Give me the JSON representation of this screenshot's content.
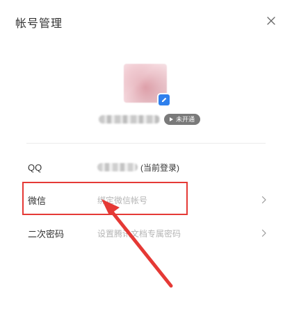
{
  "dialog": {
    "title": "帐号管理",
    "close_icon": "close-icon"
  },
  "profile": {
    "avatar_icon": "avatar",
    "badge_icon": "edit-badge-icon",
    "member_status": "未开通"
  },
  "rows": [
    {
      "label": "QQ",
      "value_suffix": "(当前登录)",
      "has_chevron": false
    },
    {
      "label": "微信",
      "value": "绑定微信帐号",
      "has_chevron": true
    },
    {
      "label": "二次密码",
      "value": "设置腾讯文档专属密码",
      "has_chevron": true
    }
  ],
  "colors": {
    "annotation": "#e53935",
    "text_primary": "#333333",
    "text_muted": "#b5b5b5"
  }
}
